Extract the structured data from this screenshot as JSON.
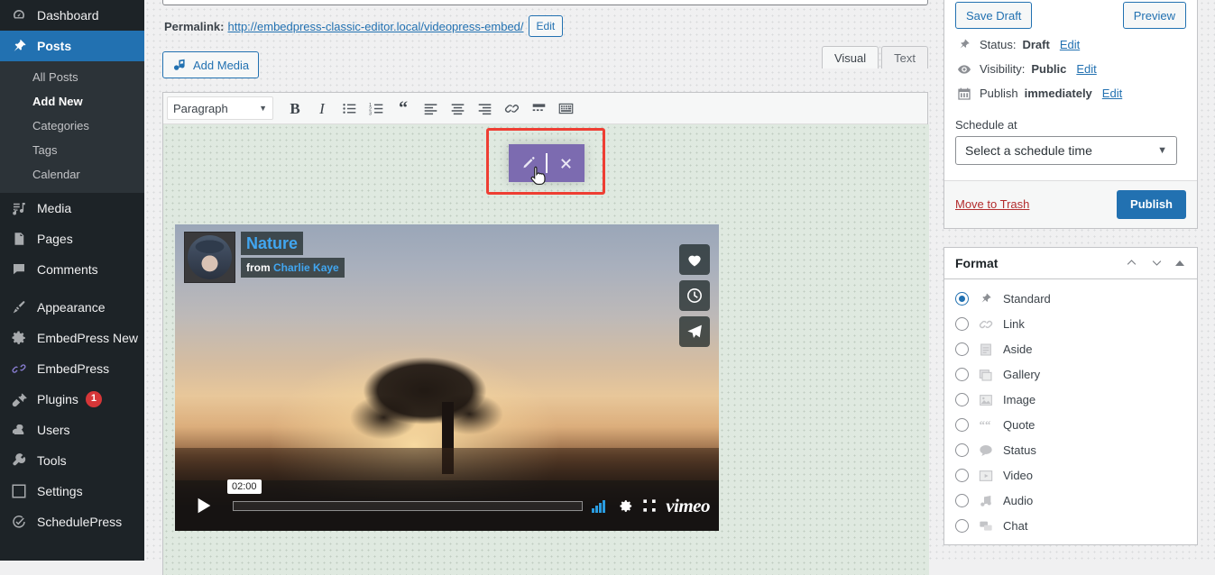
{
  "admin_menu": {
    "items": [
      {
        "label": "Dashboard",
        "icon": "dashboard-icon",
        "current": false
      },
      {
        "label": "Posts",
        "icon": "pin-icon",
        "current": true
      },
      {
        "label": "Media",
        "icon": "media-icon",
        "current": false
      },
      {
        "label": "Pages",
        "icon": "pages-icon",
        "current": false
      },
      {
        "label": "Comments",
        "icon": "comments-icon",
        "current": false
      },
      {
        "label": "Appearance",
        "icon": "brush-icon",
        "current": false
      },
      {
        "label": "EmbedPress New",
        "icon": "gear-icon",
        "current": false
      },
      {
        "label": "EmbedPress",
        "icon": "embedpress-icon",
        "current": false
      },
      {
        "label": "Plugins",
        "icon": "plug-icon",
        "current": false,
        "badge": "1"
      },
      {
        "label": "Users",
        "icon": "user-icon",
        "current": false
      },
      {
        "label": "Tools",
        "icon": "wrench-icon",
        "current": false
      },
      {
        "label": "Settings",
        "icon": "settings-icon",
        "current": false
      },
      {
        "label": "SchedulePress",
        "icon": "schedulepress-icon",
        "current": false
      }
    ],
    "posts_submenu": [
      {
        "label": "All Posts",
        "current": false
      },
      {
        "label": "Add New",
        "current": true
      },
      {
        "label": "Categories",
        "current": false
      },
      {
        "label": "Tags",
        "current": false
      },
      {
        "label": "Calendar",
        "current": false
      }
    ]
  },
  "editor": {
    "permalink": {
      "label": "Permalink:",
      "url": "http://embedpress-classic-editor.local/videopress-embed/",
      "edit_label": "Edit"
    },
    "add_media_label": "Add Media",
    "tabs": [
      {
        "label": "Visual",
        "active": true
      },
      {
        "label": "Text",
        "active": false
      }
    ],
    "toolbar": {
      "format_select": "Paragraph",
      "buttons": [
        {
          "name": "bold-icon",
          "glyph": "B"
        },
        {
          "name": "italic-icon",
          "glyph": "I"
        },
        {
          "name": "bulleted-list-icon",
          "glyph": ""
        },
        {
          "name": "numbered-list-icon",
          "glyph": ""
        },
        {
          "name": "blockquote-icon",
          "glyph": "“"
        },
        {
          "name": "align-left-icon",
          "glyph": ""
        },
        {
          "name": "align-center-icon",
          "glyph": ""
        },
        {
          "name": "align-right-icon",
          "glyph": ""
        },
        {
          "name": "link-icon",
          "glyph": ""
        },
        {
          "name": "read-more-icon",
          "glyph": ""
        },
        {
          "name": "toolbar-toggle-icon",
          "glyph": ""
        }
      ]
    },
    "embed_toolbar": {
      "edit_label": "Edit embed",
      "remove_label": "Remove embed",
      "highlight_color": "#ee3e33",
      "background_color": "#7c6bb0"
    },
    "player": {
      "provider": "vimeo",
      "title": "Nature",
      "from_label": "from",
      "author": "Charlie Kaye",
      "duration": "02:00",
      "actions": [
        {
          "name": "like-heart-icon"
        },
        {
          "name": "watch-later-clock-icon"
        },
        {
          "name": "share-paper-plane-icon"
        }
      ],
      "control_icons": [
        {
          "name": "play-icon"
        },
        {
          "name": "volume-bars-icon"
        },
        {
          "name": "settings-gear-icon"
        },
        {
          "name": "fullscreen-icon"
        }
      ],
      "logo_text": "vimeo"
    }
  },
  "publish_box": {
    "save_draft_label": "Save Draft",
    "preview_label": "Preview",
    "status": {
      "label": "Status:",
      "value": "Draft",
      "edit": "Edit",
      "icon": "pin-status-icon"
    },
    "visibility": {
      "label": "Visibility:",
      "value": "Public",
      "edit": "Edit",
      "icon": "eye-icon"
    },
    "publish_time": {
      "label": "Publish",
      "value": "immediately",
      "edit": "Edit",
      "icon": "calendar-icon"
    },
    "schedule": {
      "label": "Schedule at",
      "selected": "Select a schedule time"
    },
    "trash_label": "Move to Trash",
    "publish_label": "Publish"
  },
  "format_box": {
    "title": "Format",
    "controls": [
      {
        "name": "move-up-icon"
      },
      {
        "name": "move-down-icon"
      },
      {
        "name": "toggle-panel-icon"
      }
    ],
    "options": [
      {
        "label": "Standard",
        "icon": "pin-icon",
        "selected": true
      },
      {
        "label": "Link",
        "icon": "link-icon",
        "selected": false
      },
      {
        "label": "Aside",
        "icon": "aside-icon",
        "selected": false
      },
      {
        "label": "Gallery",
        "icon": "gallery-icon",
        "selected": false
      },
      {
        "label": "Image",
        "icon": "image-icon",
        "selected": false
      },
      {
        "label": "Quote",
        "icon": "quote-icon",
        "selected": false
      },
      {
        "label": "Status",
        "icon": "status-icon",
        "selected": false
      },
      {
        "label": "Video",
        "icon": "video-icon",
        "selected": false
      },
      {
        "label": "Audio",
        "icon": "audio-icon",
        "selected": false
      },
      {
        "label": "Chat",
        "icon": "chat-icon",
        "selected": false
      }
    ]
  },
  "colors": {
    "accent": "#2271b1",
    "menu_bg": "#1d2327",
    "editor_bg": "#dfe9e0",
    "highlight": "#ee3e33",
    "embed_purple": "#7c6bb0",
    "badge_red": "#d63638"
  }
}
